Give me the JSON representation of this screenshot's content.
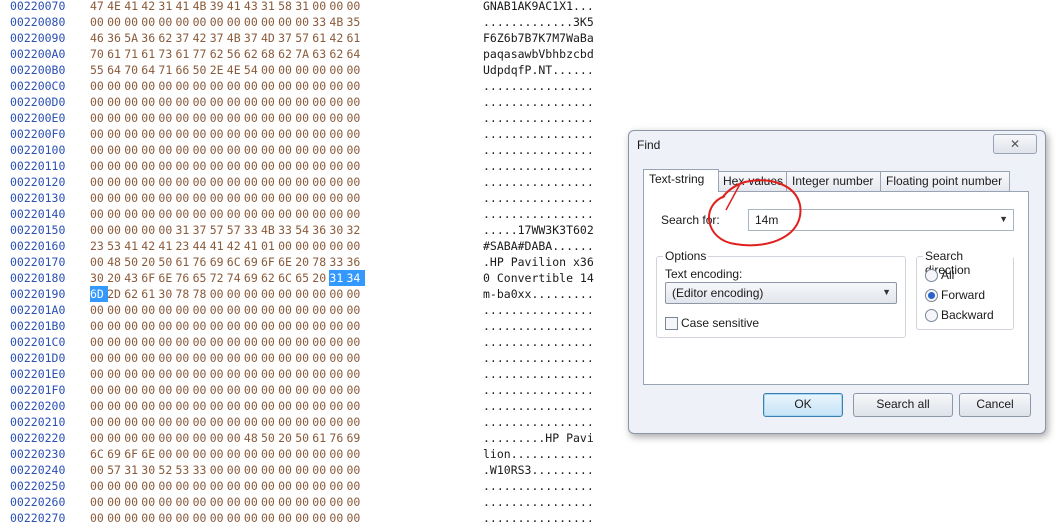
{
  "hex": {
    "rows": [
      {
        "offset": "00220070",
        "bytes": [
          "47",
          "4E",
          "41",
          "42",
          "31",
          "41",
          "4B",
          "39",
          "41",
          "43",
          "31",
          "58",
          "31",
          "00",
          "00",
          "00"
        ],
        "ascii": "GNAB1AK9AC1X1..."
      },
      {
        "offset": "00220080",
        "bytes": [
          "00",
          "00",
          "00",
          "00",
          "00",
          "00",
          "00",
          "00",
          "00",
          "00",
          "00",
          "00",
          "00",
          "33",
          "4B",
          "35"
        ],
        "ascii": ".............3K5"
      },
      {
        "offset": "00220090",
        "bytes": [
          "46",
          "36",
          "5A",
          "36",
          "62",
          "37",
          "42",
          "37",
          "4B",
          "37",
          "4D",
          "37",
          "57",
          "61",
          "42",
          "61"
        ],
        "ascii": "F6Z6b7B7K7M7WaBa"
      },
      {
        "offset": "002200A0",
        "bytes": [
          "70",
          "61",
          "71",
          "61",
          "73",
          "61",
          "77",
          "62",
          "56",
          "62",
          "68",
          "62",
          "7A",
          "63",
          "62",
          "64"
        ],
        "ascii": "paqasawbVbhbzcbd"
      },
      {
        "offset": "002200B0",
        "bytes": [
          "55",
          "64",
          "70",
          "64",
          "71",
          "66",
          "50",
          "2E",
          "4E",
          "54",
          "00",
          "00",
          "00",
          "00",
          "00",
          "00"
        ],
        "ascii": "UdpdqfP.NT......"
      },
      {
        "offset": "002200C0",
        "bytes": [
          "00",
          "00",
          "00",
          "00",
          "00",
          "00",
          "00",
          "00",
          "00",
          "00",
          "00",
          "00",
          "00",
          "00",
          "00",
          "00"
        ],
        "ascii": "................"
      },
      {
        "offset": "002200D0",
        "bytes": [
          "00",
          "00",
          "00",
          "00",
          "00",
          "00",
          "00",
          "00",
          "00",
          "00",
          "00",
          "00",
          "00",
          "00",
          "00",
          "00"
        ],
        "ascii": "................"
      },
      {
        "offset": "002200E0",
        "bytes": [
          "00",
          "00",
          "00",
          "00",
          "00",
          "00",
          "00",
          "00",
          "00",
          "00",
          "00",
          "00",
          "00",
          "00",
          "00",
          "00"
        ],
        "ascii": "................"
      },
      {
        "offset": "002200F0",
        "bytes": [
          "00",
          "00",
          "00",
          "00",
          "00",
          "00",
          "00",
          "00",
          "00",
          "00",
          "00",
          "00",
          "00",
          "00",
          "00",
          "00"
        ],
        "ascii": "................"
      },
      {
        "offset": "00220100",
        "bytes": [
          "00",
          "00",
          "00",
          "00",
          "00",
          "00",
          "00",
          "00",
          "00",
          "00",
          "00",
          "00",
          "00",
          "00",
          "00",
          "00"
        ],
        "ascii": "................"
      },
      {
        "offset": "00220110",
        "bytes": [
          "00",
          "00",
          "00",
          "00",
          "00",
          "00",
          "00",
          "00",
          "00",
          "00",
          "00",
          "00",
          "00",
          "00",
          "00",
          "00"
        ],
        "ascii": "................"
      },
      {
        "offset": "00220120",
        "bytes": [
          "00",
          "00",
          "00",
          "00",
          "00",
          "00",
          "00",
          "00",
          "00",
          "00",
          "00",
          "00",
          "00",
          "00",
          "00",
          "00"
        ],
        "ascii": "................"
      },
      {
        "offset": "00220130",
        "bytes": [
          "00",
          "00",
          "00",
          "00",
          "00",
          "00",
          "00",
          "00",
          "00",
          "00",
          "00",
          "00",
          "00",
          "00",
          "00",
          "00"
        ],
        "ascii": "................"
      },
      {
        "offset": "00220140",
        "bytes": [
          "00",
          "00",
          "00",
          "00",
          "00",
          "00",
          "00",
          "00",
          "00",
          "00",
          "00",
          "00",
          "00",
          "00",
          "00",
          "00"
        ],
        "ascii": "................"
      },
      {
        "offset": "00220150",
        "bytes": [
          "00",
          "00",
          "00",
          "00",
          "00",
          "31",
          "37",
          "57",
          "57",
          "33",
          "4B",
          "33",
          "54",
          "36",
          "30",
          "32"
        ],
        "ascii": ".....17WW3K3T602"
      },
      {
        "offset": "00220160",
        "bytes": [
          "23",
          "53",
          "41",
          "42",
          "41",
          "23",
          "44",
          "41",
          "42",
          "41",
          "01",
          "00",
          "00",
          "00",
          "00",
          "00"
        ],
        "ascii": "#SABA#DABA......"
      },
      {
        "offset": "00220170",
        "bytes": [
          "00",
          "48",
          "50",
          "20",
          "50",
          "61",
          "76",
          "69",
          "6C",
          "69",
          "6F",
          "6E",
          "20",
          "78",
          "33",
          "36"
        ],
        "ascii": ".HP Pavilion x36"
      },
      {
        "offset": "00220180",
        "bytes": [
          "30",
          "20",
          "43",
          "6F",
          "6E",
          "76",
          "65",
          "72",
          "74",
          "69",
          "62",
          "6C",
          "65",
          "20",
          "31",
          "34"
        ],
        "ascii": "0 Convertible 14"
      },
      {
        "offset": "00220190",
        "bytes": [
          "6D",
          "2D",
          "62",
          "61",
          "30",
          "78",
          "78",
          "00",
          "00",
          "00",
          "00",
          "00",
          "00",
          "00",
          "00",
          "00"
        ],
        "ascii": "m-ba0xx........."
      },
      {
        "offset": "002201A0",
        "bytes": [
          "00",
          "00",
          "00",
          "00",
          "00",
          "00",
          "00",
          "00",
          "00",
          "00",
          "00",
          "00",
          "00",
          "00",
          "00",
          "00"
        ],
        "ascii": "................"
      },
      {
        "offset": "002201B0",
        "bytes": [
          "00",
          "00",
          "00",
          "00",
          "00",
          "00",
          "00",
          "00",
          "00",
          "00",
          "00",
          "00",
          "00",
          "00",
          "00",
          "00"
        ],
        "ascii": "................"
      },
      {
        "offset": "002201C0",
        "bytes": [
          "00",
          "00",
          "00",
          "00",
          "00",
          "00",
          "00",
          "00",
          "00",
          "00",
          "00",
          "00",
          "00",
          "00",
          "00",
          "00"
        ],
        "ascii": "................"
      },
      {
        "offset": "002201D0",
        "bytes": [
          "00",
          "00",
          "00",
          "00",
          "00",
          "00",
          "00",
          "00",
          "00",
          "00",
          "00",
          "00",
          "00",
          "00",
          "00",
          "00"
        ],
        "ascii": "................"
      },
      {
        "offset": "002201E0",
        "bytes": [
          "00",
          "00",
          "00",
          "00",
          "00",
          "00",
          "00",
          "00",
          "00",
          "00",
          "00",
          "00",
          "00",
          "00",
          "00",
          "00"
        ],
        "ascii": "................"
      },
      {
        "offset": "002201F0",
        "bytes": [
          "00",
          "00",
          "00",
          "00",
          "00",
          "00",
          "00",
          "00",
          "00",
          "00",
          "00",
          "00",
          "00",
          "00",
          "00",
          "00"
        ],
        "ascii": "................"
      },
      {
        "offset": "00220200",
        "bytes": [
          "00",
          "00",
          "00",
          "00",
          "00",
          "00",
          "00",
          "00",
          "00",
          "00",
          "00",
          "00",
          "00",
          "00",
          "00",
          "00"
        ],
        "ascii": "................"
      },
      {
        "offset": "00220210",
        "bytes": [
          "00",
          "00",
          "00",
          "00",
          "00",
          "00",
          "00",
          "00",
          "00",
          "00",
          "00",
          "00",
          "00",
          "00",
          "00",
          "00"
        ],
        "ascii": "................"
      },
      {
        "offset": "00220220",
        "bytes": [
          "00",
          "00",
          "00",
          "00",
          "00",
          "00",
          "00",
          "00",
          "00",
          "48",
          "50",
          "20",
          "50",
          "61",
          "76",
          "69"
        ],
        "ascii": ".........HP Pavi"
      },
      {
        "offset": "00220230",
        "bytes": [
          "6C",
          "69",
          "6F",
          "6E",
          "00",
          "00",
          "00",
          "00",
          "00",
          "00",
          "00",
          "00",
          "00",
          "00",
          "00",
          "00"
        ],
        "ascii": "lion............"
      },
      {
        "offset": "00220240",
        "bytes": [
          "00",
          "57",
          "31",
          "30",
          "52",
          "53",
          "33",
          "00",
          "00",
          "00",
          "00",
          "00",
          "00",
          "00",
          "00",
          "00"
        ],
        "ascii": ".W10RS3........."
      },
      {
        "offset": "00220250",
        "bytes": [
          "00",
          "00",
          "00",
          "00",
          "00",
          "00",
          "00",
          "00",
          "00",
          "00",
          "00",
          "00",
          "00",
          "00",
          "00",
          "00"
        ],
        "ascii": "................"
      },
      {
        "offset": "00220260",
        "bytes": [
          "00",
          "00",
          "00",
          "00",
          "00",
          "00",
          "00",
          "00",
          "00",
          "00",
          "00",
          "00",
          "00",
          "00",
          "00",
          "00"
        ],
        "ascii": "................"
      },
      {
        "offset": "00220270",
        "bytes": [
          "00",
          "00",
          "00",
          "00",
          "00",
          "00",
          "00",
          "00",
          "00",
          "00",
          "00",
          "00",
          "00",
          "00",
          "00",
          "00"
        ],
        "ascii": "................"
      }
    ]
  },
  "dialog": {
    "title": "Find",
    "close_glyph": "✕",
    "tabs": [
      {
        "label": "Text-string"
      },
      {
        "label": "Hex-values"
      },
      {
        "label": "Integer number"
      },
      {
        "label": "Floating point number"
      }
    ],
    "search_label": "Search for:",
    "search_value": "14m",
    "options_title": "Options",
    "encoding_label": "Text encoding:",
    "encoding_value": "(Editor encoding)",
    "case_sensitive_label": "Case sensitive",
    "direction_title": "Search direction",
    "directions": [
      {
        "label": "All",
        "selected": false
      },
      {
        "label": "Forward",
        "selected": true
      },
      {
        "label": "Backward",
        "selected": false
      }
    ],
    "ok_label": "OK",
    "search_all_label": "Search all",
    "cancel_label": "Cancel"
  },
  "colors": {
    "offset": "#2a4fb5",
    "byte": "#8a5a3a",
    "selection": "#3399ff",
    "annotation": "#e0201c"
  }
}
